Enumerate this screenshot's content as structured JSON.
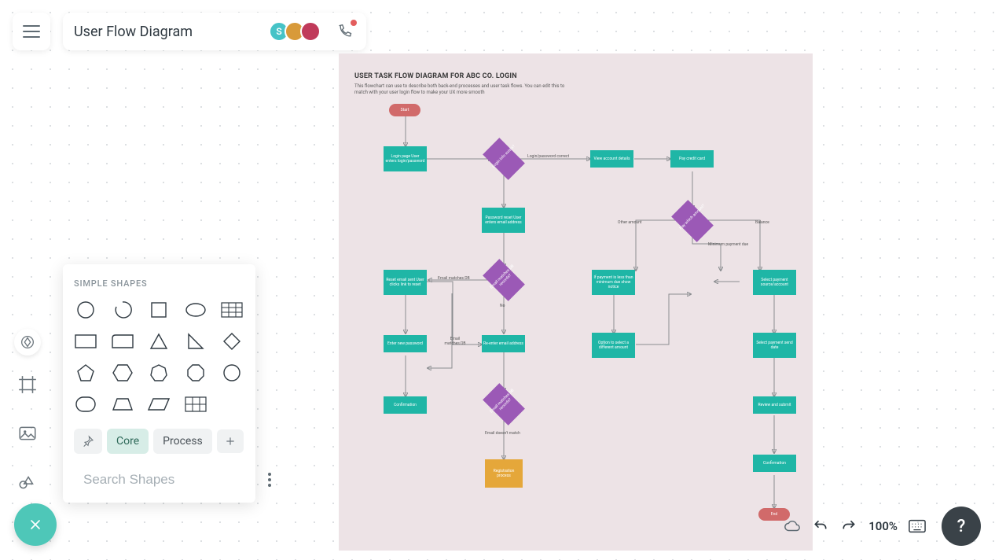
{
  "header": {
    "title": "User Flow Diagram",
    "avatars": [
      {
        "initial": "S",
        "color": "#46c3c7"
      },
      {
        "initial": "",
        "color": "#d89a3a"
      },
      {
        "initial": "",
        "color": "#c03a5a"
      }
    ]
  },
  "shapes_panel": {
    "section_label": "SIMPLE SHAPES",
    "tabs": {
      "core": "Core",
      "process": "Process"
    },
    "search_placeholder": "Search Shapes"
  },
  "zoom": "100%",
  "help_label": "?",
  "diagram": {
    "title": "USER TASK FLOW DIAGRAM FOR ABC CO. LOGIN",
    "subtitle": "This flowchart can use to describe both back-end processes and user task flows. You can edit this to match with your user login flow to make your UX more smooth",
    "nodes": {
      "start": "Start",
      "login_page": "Login page\nUser enters\nlogin/password",
      "login_exists": "Login info exists?",
      "view_account": "View account details",
      "pay_card": "Pay credit card",
      "pw_reset": "Password reset\nUser enters\nemail address",
      "email_matches": "Email matches DB records?",
      "reset_sent": "Reset email sent\nUser clicks link to reset",
      "enter_new_pw": "Enter new password",
      "reenter_email": "Re-enter email address",
      "email_matches2": "Email matches DB records?",
      "registration": "Registration process",
      "confirmation": "Confirmation",
      "pay_which": "Pay which amount?",
      "other_amount_lbl": "Other amount",
      "balance_lbl": "Balance",
      "min_due_lbl": "Minimum payment due",
      "if_less": "If payment is less than minimum due show notice",
      "select_source": "Select payment source/account",
      "option_select": "Option to select a different amount",
      "select_date": "Select payment send date",
      "review_submit": "Review and submit",
      "confirmation2": "Confirmation",
      "end": "End",
      "lbl_correct": "Login/password correct",
      "lbl_email_matches": "Email matches DB",
      "lbl_no": "No",
      "lbl_email_matches2": "Email matches DB",
      "lbl_no_match": "Email doesn't match"
    }
  }
}
